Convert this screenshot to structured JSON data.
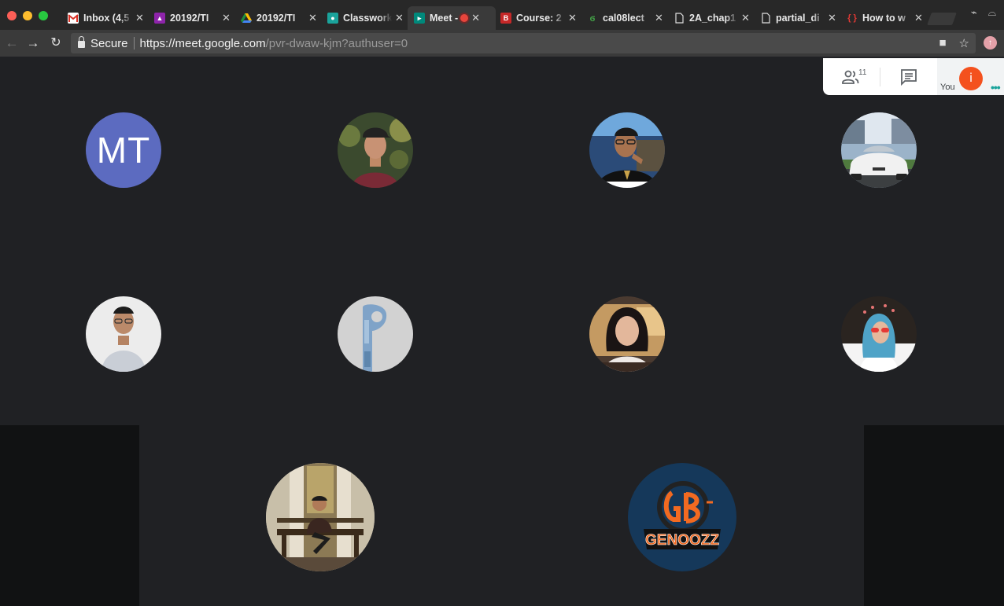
{
  "browser": {
    "tabs": [
      {
        "title": "Inbox (4,5",
        "favicon": "gmail-icon",
        "color": "#d93025"
      },
      {
        "title": "20192/TI",
        "favicon": "classroom-people-icon",
        "color": "#8e24aa"
      },
      {
        "title": "20192/TI",
        "favicon": "drive-icon",
        "color": "#fbbc04"
      },
      {
        "title": "Classwork",
        "favicon": "classroom-icon",
        "color": "#1e8e3e"
      },
      {
        "title": "Meet -",
        "favicon": "meet-icon",
        "color": "#00897b",
        "active": true,
        "recording": true
      },
      {
        "title": "Course: 2",
        "favicon": "course-icon",
        "color": "#c62828"
      },
      {
        "title": "cal08lect",
        "favicon": "pdf-leaf-icon",
        "color": "#2e7d32"
      },
      {
        "title": "2A_chap1",
        "favicon": "document-icon",
        "color": "#dddddd"
      },
      {
        "title": "partial_di",
        "favicon": "document-icon",
        "color": "#dddddd"
      },
      {
        "title": "How to w",
        "favicon": "code-braces-icon",
        "color": "#e53935"
      }
    ],
    "secure_label": "Secure",
    "url_host": "https://meet.google.com",
    "url_path": "/pvr-dwaw-kjm?authuser=0"
  },
  "meet": {
    "participant_count": "11",
    "you_label": "You",
    "you_initial": "i",
    "accent": "#f4511e"
  },
  "participants": [
    {
      "initials": "MT",
      "color": "#5c6bc0"
    },
    {
      "photo": "photo-man-cap"
    },
    {
      "photo": "photo-man-glasses"
    },
    {
      "photo": "photo-white-car"
    },
    {
      "photo": "photo-boy-white-wall"
    },
    {
      "photo": "letter-p-logo"
    },
    {
      "photo": "photo-girl-bokeh"
    },
    {
      "photo": "photo-hijab-sunglasses"
    },
    {
      "photo": "photo-man-bench"
    },
    {
      "photo": "genoozz-logo",
      "logo_text": "GENOOZZ"
    }
  ]
}
